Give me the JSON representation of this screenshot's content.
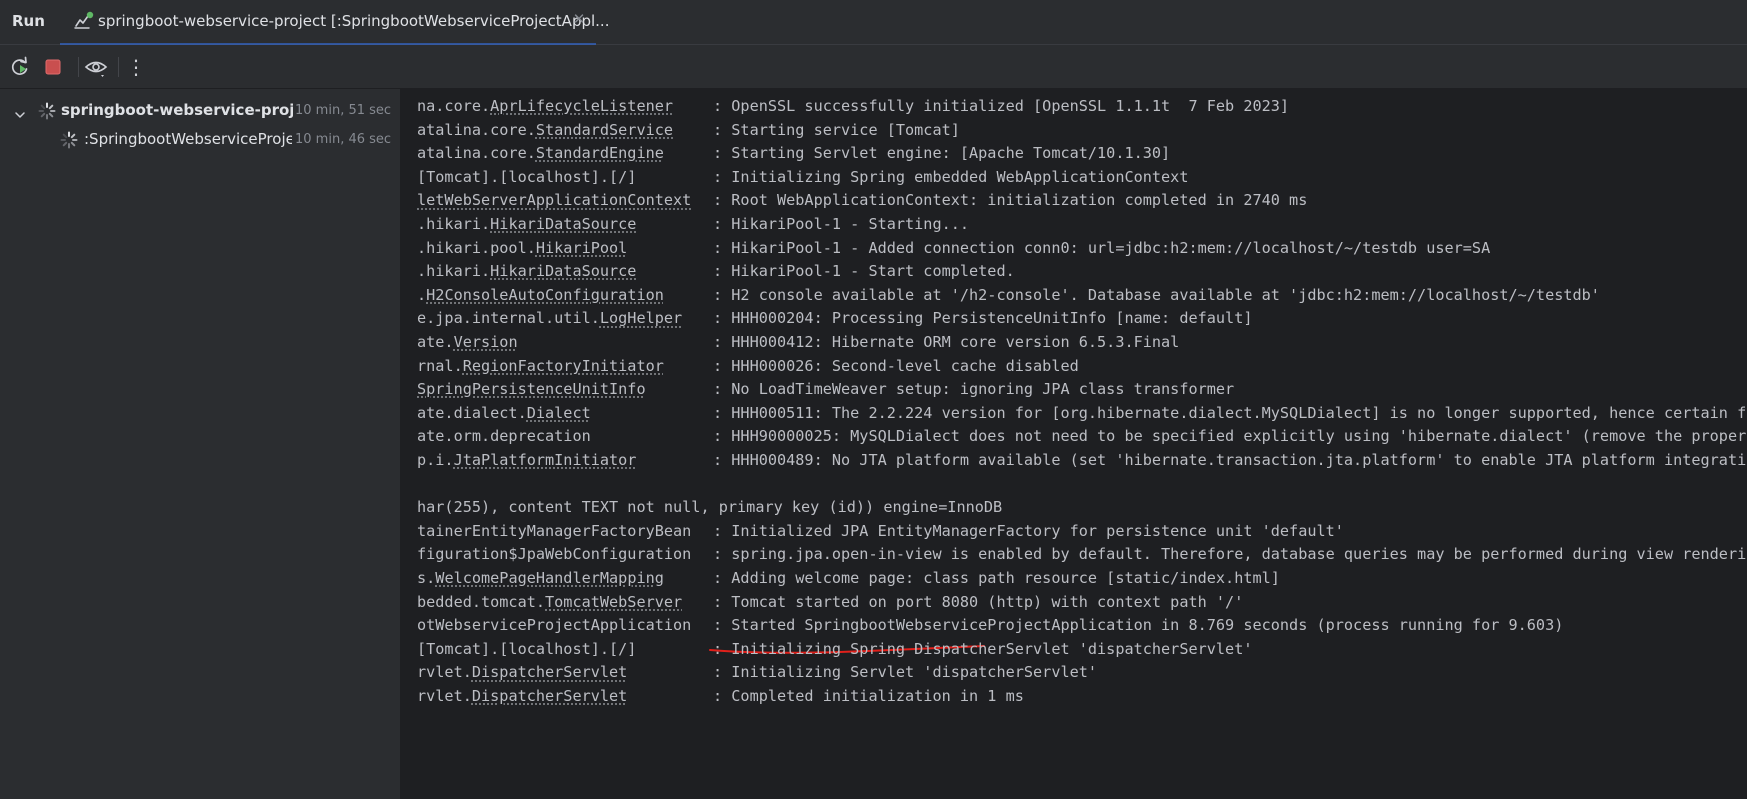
{
  "tabbar": {
    "panel_title": "Run",
    "run_tab_label": "springboot-webservice-project [:SpringbootWebserviceProjectAppl...",
    "close_glyph": "✕",
    "icons": {
      "tab": "run-config-icon",
      "close": "close-icon"
    }
  },
  "toolbar": {
    "buttons": [
      "rerun-icon",
      "stop-icon",
      "eye-icon",
      "more-vertical-icon"
    ],
    "more_glyph": "⋮"
  },
  "tree": {
    "items": [
      {
        "label": "springboot-webservice-project [:",
        "time": "10 min, 51 sec",
        "bold": true,
        "expanded": true
      },
      {
        "label": ":SpringbootWebserviceProjectA",
        "time": "10 min, 46 sec",
        "bold": false
      }
    ]
  },
  "console": {
    "lines": [
      {
        "parts": [
          "na.core.",
          "AprLifecycleListener",
          ""
        ],
        "message": ": OpenSSL successfully initialized [OpenSSL 1.1.1t  7 Feb 2023]"
      },
      {
        "parts": [
          "atalina.core.",
          "StandardService",
          ""
        ],
        "message": ": Starting service [Tomcat]"
      },
      {
        "parts": [
          "atalina.core.",
          "StandardEngine",
          ""
        ],
        "message": ": Starting Servlet engine: [Apache Tomcat/10.1.30]"
      },
      {
        "parts": [
          "[Tomcat].[localhost].[/]",
          "",
          ""
        ],
        "message": ": Initializing Spring embedded WebApplicationContext"
      },
      {
        "parts": [
          "",
          "letWebServerApplicationContext",
          ""
        ],
        "message": ": Root WebApplicationContext: initialization completed in 2740 ms"
      },
      {
        "parts": [
          ".hikari.",
          "HikariDataSource",
          ""
        ],
        "message": ": HikariPool-1 - Starting..."
      },
      {
        "parts": [
          ".hikari.pool.",
          "HikariPool",
          ""
        ],
        "message": ": HikariPool-1 - Added connection conn0: url=jdbc:h2:mem://localhost/~/testdb user=SA"
      },
      {
        "parts": [
          ".hikari.",
          "HikariDataSource",
          ""
        ],
        "message": ": HikariPool-1 - Start completed."
      },
      {
        "parts": [
          ".",
          "H2ConsoleAutoConfiguration",
          ""
        ],
        "message": ": H2 console available at '/h2-console'. Database available at 'jdbc:h2:mem://localhost/~/testdb'"
      },
      {
        "parts": [
          "e.jpa.internal.util.",
          "LogHelper",
          ""
        ],
        "message": ": HHH000204: Processing PersistenceUnitInfo [name: default]"
      },
      {
        "parts": [
          "ate.",
          "Version",
          ""
        ],
        "message": ": HHH000412: Hibernate ORM core version 6.5.3.Final"
      },
      {
        "parts": [
          "rnal.",
          "RegionFactoryInitiator",
          ""
        ],
        "message": ": HHH000026: Second-level cache disabled"
      },
      {
        "parts": [
          "",
          "SpringPersistenceUnitInfo",
          ""
        ],
        "message": ": No LoadTimeWeaver setup: ignoring JPA class transformer"
      },
      {
        "parts": [
          "ate.dialect.",
          "Dialect",
          ""
        ],
        "message": ": HHH000511: The 2.2.224 version for [org.hibernate.dialect.MySQLDialect] is no longer supported, hence certain featu"
      },
      {
        "parts": [
          "ate.orm.deprecation",
          "",
          ""
        ],
        "message": ": HHH90000025: MySQLDialect does not need to be specified explicitly using 'hibernate.dialect' (remove the property s"
      },
      {
        "parts": [
          "p.i.",
          "JtaPlatformInitiator",
          ""
        ],
        "message": ": HHH000489: No JTA platform available (set 'hibernate.transaction.jta.platform' to enable JTA platform integration)"
      },
      {
        "parts": [
          "",
          "",
          ""
        ],
        "message": ""
      },
      {
        "parts": [
          "har(255), content TEXT not null, primary key (id)) engine=InnoDB",
          "",
          ""
        ],
        "message": ""
      },
      {
        "parts": [
          "tainerEntityManagerFactoryBean ",
          "",
          ""
        ],
        "message": ": Initialized JPA EntityManagerFactory for persistence unit 'default'"
      },
      {
        "parts": [
          "figuration$JpaWebConfiguration ",
          "",
          ""
        ],
        "message": ": spring.jpa.open-in-view is enabled by default. Therefore, database queries may be performed during view rendering."
      },
      {
        "parts": [
          "s.",
          "WelcomePageHandlerMapping",
          ""
        ],
        "message": ": Adding welcome page: class path resource [static/index.html]"
      },
      {
        "parts": [
          "bedded.tomcat.",
          "TomcatWebServer",
          ""
        ],
        "message": ": Tomcat started on port 8080 (http) with context path '/'"
      },
      {
        "parts": [
          "otWebserviceProjectApplication ",
          "",
          ""
        ],
        "message": ": Started SpringbootWebserviceProjectApplication in 8.769 seconds (process running for 9.603)"
      },
      {
        "parts": [
          "[Tomcat].[localhost].[/]",
          "",
          ""
        ],
        "message": ": Initializing Spring DispatcherServlet 'dispatcherServlet'"
      },
      {
        "parts": [
          "rvlet.",
          "DispatcherServlet",
          ""
        ],
        "message": ": Initializing Servlet 'dispatcherServlet'"
      },
      {
        "parts": [
          "rvlet.",
          "DispatcherServlet",
          ""
        ],
        "message": ": Completed initialization in 1 ms"
      }
    ],
    "highlight_color": "#e0201b"
  },
  "colors": {
    "accent": "#3574f0",
    "stop_red": "#c94f4f",
    "rerun_green": "#5fb865"
  }
}
